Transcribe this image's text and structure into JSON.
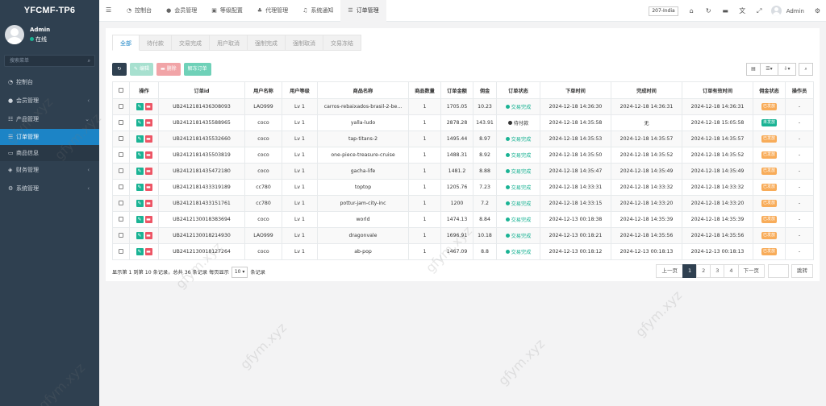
{
  "sidebar": {
    "logo": "YFCMF-TP6",
    "user_name": "Admin",
    "user_status": "在线",
    "search_placeholder": "搜索菜单",
    "items": [
      {
        "label": "控制台",
        "icon": "dashboard-icon"
      },
      {
        "label": "会员管理",
        "icon": "users-icon",
        "chevron": "‹"
      },
      {
        "label": "产品管理",
        "icon": "products-icon",
        "chevron": "‹"
      },
      {
        "label": "订单管理",
        "icon": "orders-icon"
      },
      {
        "label": "商品信息",
        "icon": "monitor-icon"
      },
      {
        "label": "财务管理",
        "icon": "finance-icon",
        "chevron": "‹"
      },
      {
        "label": "系统管理",
        "icon": "cogs-icon",
        "chevron": "‹"
      }
    ]
  },
  "topbar": {
    "tabs": [
      {
        "label": "控制台",
        "icon": "dashboard-icon"
      },
      {
        "label": "会员管理",
        "icon": "user-icon"
      },
      {
        "label": "等级配置",
        "icon": "settings-icon"
      },
      {
        "label": "代理管理",
        "icon": "agent-icon"
      },
      {
        "label": "系统通知",
        "icon": "bell-icon"
      },
      {
        "label": "订单管理",
        "icon": "list-icon"
      }
    ],
    "domain": "207-India",
    "admin": "Admin"
  },
  "subtabs": [
    "全部",
    "待付款",
    "交易完成",
    "用户取消",
    "强制完成",
    "强制取消",
    "交易冻结"
  ],
  "toolbar": {
    "edit": "编辑",
    "delete": "删除",
    "unfreeze": "解冻订单"
  },
  "table": {
    "headers": [
      "操作",
      "订单id",
      "用户名称",
      "用户等级",
      "商品名称",
      "商品数量",
      "订单金额",
      "佣金",
      "订单状态",
      "下单时间",
      "完成时间",
      "订单有效时间",
      "佣金状态",
      "操作员"
    ],
    "rows": [
      [
        "UB2412181436308093",
        "LAO999",
        "Lv 1",
        "carros-rebaixados-brasil-2-be...",
        "1",
        "1705.05",
        "10.23",
        "交易完成",
        "2024-12-18 14:36:30",
        "2024-12-18 14:36:31",
        "2024-12-18 14:36:31",
        "已发放",
        "-"
      ],
      [
        "UB2412181435588965",
        "coco",
        "Lv 1",
        "yalla-ludo",
        "1",
        "2878.28",
        "143.91",
        "待付款",
        "2024-12-18 14:35:58",
        "无",
        "2024-12-18 15:05:58",
        "未发放",
        "-"
      ],
      [
        "UB2412181435532660",
        "coco",
        "Lv 1",
        "tap-titans-2",
        "1",
        "1495.44",
        "8.97",
        "交易完成",
        "2024-12-18 14:35:53",
        "2024-12-18 14:35:57",
        "2024-12-18 14:35:57",
        "已发放",
        "-"
      ],
      [
        "UB2412181435503819",
        "coco",
        "Lv 1",
        "one-piece-treasure-cruise",
        "1",
        "1488.31",
        "8.92",
        "交易完成",
        "2024-12-18 14:35:50",
        "2024-12-18 14:35:52",
        "2024-12-18 14:35:52",
        "已发放",
        "-"
      ],
      [
        "UB2412181435472180",
        "coco",
        "Lv 1",
        "gacha-life",
        "1",
        "1481.2",
        "8.88",
        "交易完成",
        "2024-12-18 14:35:47",
        "2024-12-18 14:35:49",
        "2024-12-18 14:35:49",
        "已发放",
        "-"
      ],
      [
        "UB2412181433319189",
        "cc780",
        "Lv 1",
        "toptop",
        "1",
        "1205.76",
        "7.23",
        "交易完成",
        "2024-12-18 14:33:31",
        "2024-12-18 14:33:32",
        "2024-12-18 14:33:32",
        "已发放",
        "-"
      ],
      [
        "UB2412181433151761",
        "cc780",
        "Lv 1",
        "pottur-jam-city-inc",
        "1",
        "1200",
        "7.2",
        "交易完成",
        "2024-12-18 14:33:15",
        "2024-12-18 14:33:20",
        "2024-12-18 14:33:20",
        "已发放",
        "-"
      ],
      [
        "UB2412130018383694",
        "coco",
        "Lv 1",
        "world",
        "1",
        "1474.13",
        "8.84",
        "交易完成",
        "2024-12-13 00:18:38",
        "2024-12-18 14:35:39",
        "2024-12-18 14:35:39",
        "已发放",
        "-"
      ],
      [
        "UB2412130018214930",
        "LAO999",
        "Lv 1",
        "dragonvale",
        "1",
        "1696.91",
        "10.18",
        "交易完成",
        "2024-12-13 00:18:21",
        "2024-12-18 14:35:56",
        "2024-12-18 14:35:56",
        "已发放",
        "-"
      ],
      [
        "UB2412130018127264",
        "coco",
        "Lv 1",
        "ab-pop",
        "1",
        "1467.09",
        "8.8",
        "交易完成",
        "2024-12-13 00:18:12",
        "2024-12-13 00:18:13",
        "2024-12-13 00:18:13",
        "已发放",
        "-"
      ]
    ]
  },
  "footer": {
    "info_prefix": "显示第 1 到第 10 条记录，总共 36 条记录 每页显示",
    "page_size": "10",
    "info_suffix": "条记录"
  },
  "pager": {
    "prev": "上一页",
    "pages": [
      "1",
      "2",
      "3",
      "4"
    ],
    "next": "下一页",
    "go": "跳转"
  },
  "watermark": "gfym.xyz",
  "colors": {
    "sidebar_bg": "#2f4050",
    "accent": "#1c84c6",
    "success": "#1ab394",
    "danger": "#ed5565",
    "warning": "#f8ac59"
  }
}
